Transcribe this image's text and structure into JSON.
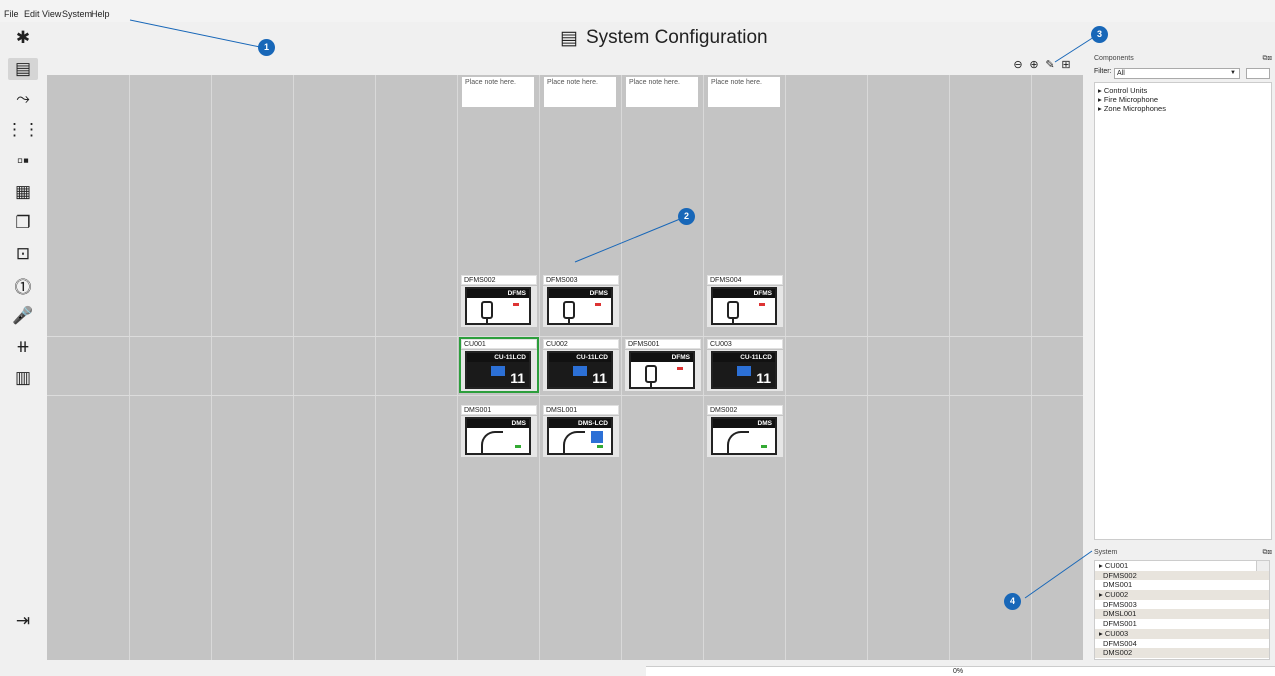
{
  "menu": [
    "File",
    "Edit",
    "View",
    "System",
    "Help"
  ],
  "title": "System Configuration",
  "toolbar": [
    "zoom-out-icon",
    "zoom-in-icon",
    "tools-icon",
    "fit-icon"
  ],
  "notes": [
    "Place note here.",
    "Place note here.",
    "Place note here.",
    "Place note here."
  ],
  "devices": {
    "dfms002": {
      "label": "DFMS002",
      "model": "DFMS"
    },
    "dfms003": {
      "label": "DFMS003",
      "model": "DFMS"
    },
    "dfms004": {
      "label": "DFMS004",
      "model": "DFMS"
    },
    "cu001": {
      "label": "CU001",
      "model": "CU-11LCD",
      "num": "11"
    },
    "cu002": {
      "label": "CU002",
      "model": "CU-11LCD",
      "num": "11"
    },
    "dfms001": {
      "label": "DFMS001",
      "model": "DFMS"
    },
    "cu003": {
      "label": "CU003",
      "model": "CU-11LCD",
      "num": "11"
    },
    "dms001": {
      "label": "DMS001",
      "model": "DMS"
    },
    "dmsl001": {
      "label": "DMSL001",
      "model": "DMS-LCD"
    },
    "dms002": {
      "label": "DMS002",
      "model": "DMS"
    }
  },
  "components": {
    "title": "Components",
    "filter_label": "Filter:",
    "filter_value": "All",
    "items": [
      "▸ Control Units",
      "▸ Fire Microphone",
      "▸ Zone Microphones"
    ]
  },
  "system": {
    "title": "System",
    "items": [
      "▸ CU001",
      "DFMS002",
      "DMS001",
      "▸ CU002",
      "DFMS003",
      "DMSL001",
      "DFMS001",
      "▸ CU003",
      "DFMS004",
      "DMS002"
    ]
  },
  "status": {
    "progress": "0%"
  },
  "callouts": [
    "1",
    "2",
    "3",
    "4"
  ]
}
